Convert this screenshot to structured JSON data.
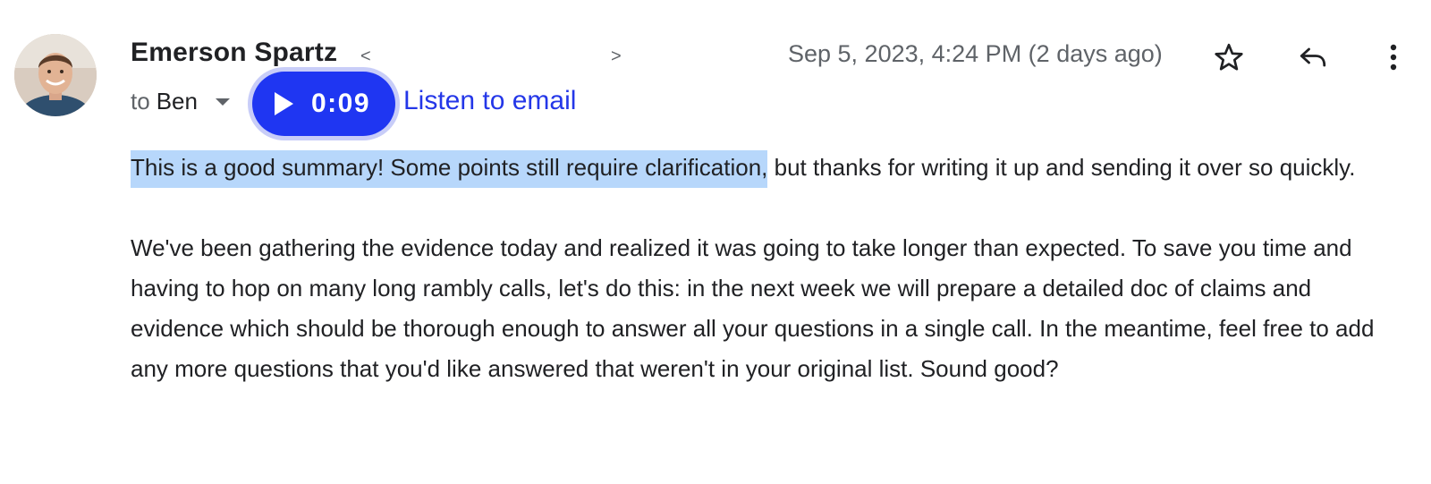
{
  "sender": {
    "name": "Emerson Spartz",
    "email_open": "<",
    "email_close": ">"
  },
  "timestamp": "Sep 5, 2023, 4:24 PM (2 days ago)",
  "recipients": {
    "prefix": "to",
    "name": "Ben"
  },
  "audio": {
    "time": "0:09",
    "listen_label": "Listen to email",
    "accent": "#1f36f2"
  },
  "body": {
    "paragraph1_highlighted": "This is a good summary! Some points still require clarification,",
    "paragraph1_rest": " but thanks for writing it up and sending it over so quickly.",
    "paragraph2": "We've been gathering the evidence today and realized it was going to take longer than expected. To save you time and having to hop on many long rambly calls, let's do this: in the next week we will prepare a detailed doc of claims and evidence which should be thorough enough to answer all your questions in a single call. In the meantime, feel free to add any more questions that you'd like answered that weren't in your original list. Sound good?"
  },
  "icons": {
    "star": "star-icon",
    "reply": "reply-icon",
    "more": "more-vertical-icon",
    "play": "play-icon",
    "dropdown": "chevron-down-icon"
  },
  "colors": {
    "highlight": "#b7d7fb",
    "link": "#2437e8",
    "secondary_text": "#5f6368"
  }
}
